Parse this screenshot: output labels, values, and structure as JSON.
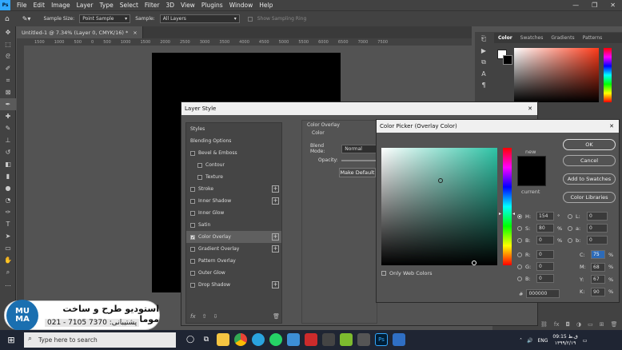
{
  "menubar": {
    "logo": "Ps",
    "items": [
      "File",
      "Edit",
      "Image",
      "Layer",
      "Type",
      "Select",
      "Filter",
      "3D",
      "View",
      "Plugins",
      "Window",
      "Help"
    ]
  },
  "window_controls": {
    "minimize": "—",
    "restore": "❐",
    "close": "✕"
  },
  "options_bar": {
    "sample_size_label": "Sample Size:",
    "sample_size_value": "Point Sample",
    "sample_label": "Sample:",
    "sample_value": "All Layers",
    "show_ring_label": "Show Sampling Ring"
  },
  "document_tab": {
    "title": "Untitled-1 @ 7.34% (Layer 0, CMYK/16) *",
    "close": "×"
  },
  "ruler_ticks": [
    "1500",
    "1000",
    "500",
    "0",
    "500",
    "1000",
    "1500",
    "2000",
    "2500",
    "3000",
    "3500",
    "4000",
    "4500",
    "5000",
    "5500",
    "6000",
    "6500",
    "7000",
    "7500"
  ],
  "right_panel": {
    "tabs": [
      "Color",
      "Swatches",
      "Gradients",
      "Patterns"
    ]
  },
  "layer_style": {
    "title": "Layer Style",
    "close": "✕",
    "items": [
      {
        "label": "Styles",
        "checkbox": false,
        "plus": false,
        "indent": false
      },
      {
        "label": "Blending Options",
        "checkbox": false,
        "plus": false,
        "indent": false
      },
      {
        "label": "Bevel & Emboss",
        "checkbox": true,
        "plus": false,
        "indent": false
      },
      {
        "label": "Contour",
        "checkbox": true,
        "plus": false,
        "indent": true
      },
      {
        "label": "Texture",
        "checkbox": true,
        "plus": false,
        "indent": true
      },
      {
        "label": "Stroke",
        "checkbox": true,
        "plus": true,
        "indent": false
      },
      {
        "label": "Inner Shadow",
        "checkbox": true,
        "plus": true,
        "indent": false
      },
      {
        "label": "Inner Glow",
        "checkbox": true,
        "plus": false,
        "indent": false
      },
      {
        "label": "Satin",
        "checkbox": true,
        "plus": false,
        "indent": false
      },
      {
        "label": "Color Overlay",
        "checkbox": true,
        "plus": true,
        "indent": false,
        "selected": true,
        "checked": true
      },
      {
        "label": "Gradient Overlay",
        "checkbox": true,
        "plus": true,
        "indent": false
      },
      {
        "label": "Pattern Overlay",
        "checkbox": true,
        "plus": false,
        "indent": false
      },
      {
        "label": "Outer Glow",
        "checkbox": true,
        "plus": false,
        "indent": false
      },
      {
        "label": "Drop Shadow",
        "checkbox": true,
        "plus": true,
        "indent": false
      }
    ],
    "fx_label": "fx",
    "section_title": "Color Overlay",
    "section_sub": "Color",
    "blend_mode_label": "Blend Mode:",
    "blend_mode_value": "Normal",
    "opacity_label": "Opacity:",
    "make_default": "Make Default"
  },
  "color_picker": {
    "title": "Color Picker (Overlay Color)",
    "close": "✕",
    "new_label": "new",
    "current_label": "current",
    "ok": "OK",
    "cancel": "Cancel",
    "add_swatches": "Add to Swatches",
    "color_libraries": "Color Libraries",
    "only_web": "Only Web Colors",
    "hsb": [
      {
        "label": "H:",
        "value": "154",
        "unit": "°"
      },
      {
        "label": "S:",
        "value": "80",
        "unit": "%"
      },
      {
        "label": "B:",
        "value": "0",
        "unit": "%"
      }
    ],
    "rgb": [
      {
        "label": "R:",
        "value": "0"
      },
      {
        "label": "G:",
        "value": "0"
      },
      {
        "label": "B:",
        "value": "0"
      }
    ],
    "lab": [
      {
        "label": "L:",
        "value": "0"
      },
      {
        "label": "a:",
        "value": "0"
      },
      {
        "label": "b:",
        "value": "0"
      }
    ],
    "cmyk": [
      {
        "label": "C:",
        "value": "75",
        "unit": "%"
      },
      {
        "label": "M:",
        "value": "68",
        "unit": "%"
      },
      {
        "label": "Y:",
        "value": "67",
        "unit": "%"
      },
      {
        "label": "K:",
        "value": "90",
        "unit": "%"
      }
    ],
    "hex_label": "#",
    "hex_value": "000000",
    "new_color": "#000000",
    "field_hue_color": "#2ec4a6"
  },
  "banner": {
    "line1": "استودیو طرح و ساخت موما",
    "line2": "پشتیبانی: 7370 7105 - 021",
    "logo": "MU MA",
    "logo_color": "#1a6fb0"
  },
  "taskbar": {
    "search_placeholder": "Type here to search",
    "lang": "ENG",
    "time": "09:15 ق.ظ",
    "date": "۱۳۹۹/۲/۱۹"
  }
}
